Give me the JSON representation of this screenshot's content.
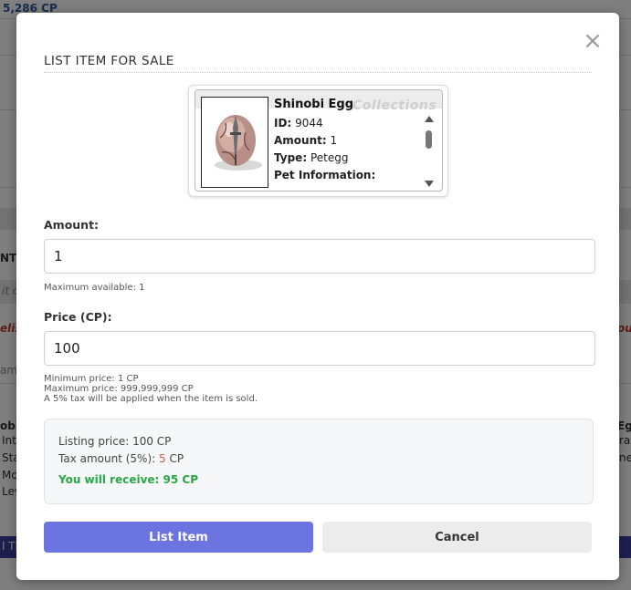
{
  "background": {
    "cp_balance": "5,286 CP",
    "fragments": [
      "NT",
      "it o",
      "elis",
      "ame",
      "obi",
      "Inti",
      "Sta",
      "Mo",
      "Lev",
      "Eg",
      "ral",
      "ned",
      "our",
      "l Th"
    ]
  },
  "modal": {
    "title": "LIST ITEM FOR SALE",
    "close_symbol": "×",
    "item": {
      "name": "Shinobi Egg",
      "watermark": "Collections",
      "id_label": "ID:",
      "id_value": "9044",
      "amount_label": "Amount:",
      "amount_value": "1",
      "type_label": "Type:",
      "type_value": "Petegg",
      "pet_info_label": "Pet Information:",
      "icon": "egg-icon"
    },
    "amount": {
      "label": "Amount:",
      "value": "1",
      "hint": "Maximum available: 1"
    },
    "price": {
      "label": "Price (CP):",
      "value": "100",
      "hints": [
        "Minimum price: 1 CP",
        "Maximum price: 999,999,999 CP",
        "A 5% tax will be applied when the item is sold."
      ]
    },
    "summary": {
      "listing_price": "Listing price: 100 CP",
      "tax_label": "Tax amount (5%):",
      "tax_value": "5",
      "tax_unit": "CP",
      "receive": "You will receive: 95 CP"
    },
    "buttons": {
      "list": "List Item",
      "cancel": "Cancel"
    }
  },
  "colors": {
    "primary_button": "#6b74e0",
    "receive_text": "#28a745",
    "tax_value": "#d9534f",
    "overlay": "rgba(0,0,0,0.5)"
  }
}
